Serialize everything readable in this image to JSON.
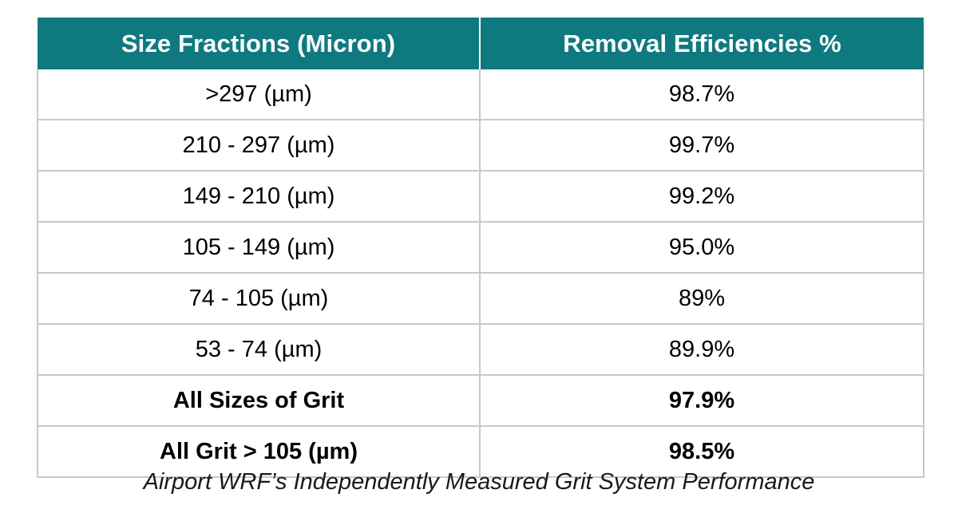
{
  "table": {
    "headers": [
      {
        "label": "Size Fractions (Micron)"
      },
      {
        "label": "Removal Efficiencies %"
      }
    ],
    "rows": [
      {
        "size": ">297 (µm)",
        "efficiency": "98.7%",
        "emphasis": false
      },
      {
        "size": "210 - 297 (µm)",
        "efficiency": "99.7%",
        "emphasis": false
      },
      {
        "size": "149 - 210 (µm)",
        "efficiency": "99.2%",
        "emphasis": false
      },
      {
        "size": "105 - 149 (µm)",
        "efficiency": "95.0%",
        "emphasis": false
      },
      {
        "size": "74 - 105 (µm)",
        "efficiency": "89%",
        "emphasis": false
      },
      {
        "size": "53 - 74 (µm)",
        "efficiency": "89.9%",
        "emphasis": false
      },
      {
        "size": "All Sizes of Grit",
        "efficiency": "97.9%",
        "emphasis": true
      },
      {
        "size": "All Grit > 105 (µm)",
        "efficiency": "98.5%",
        "emphasis": true
      }
    ]
  },
  "caption": {
    "text": "Airport WRF’s Independently Measured Grit System Performance"
  },
  "colors": {
    "header_background": "#0E7A80",
    "header_text": "#FFFFFF",
    "grid_line": "#C9C9C9",
    "body_text": "#000000",
    "page_background": "#FFFFFF"
  },
  "chart_data": {
    "type": "table",
    "title": "Airport WRF’s Independently Measured Grit System Performance",
    "columns": [
      "Size Fractions (Micron)",
      "Removal Efficiencies %"
    ],
    "categories": [
      ">297 (µm)",
      "210 - 297 (µm)",
      "149 - 210 (µm)",
      "105 - 149 (µm)",
      "74 - 105 (µm)",
      "53 - 74 (µm)",
      "All Sizes of Grit",
      "All Grit > 105 (µm)"
    ],
    "values": [
      98.7,
      99.7,
      99.2,
      95.0,
      89,
      89.9,
      97.9,
      98.5
    ],
    "value_labels": [
      "98.7%",
      "99.7%",
      "99.2%",
      "95.0%",
      "89%",
      "89.9%",
      "97.9%",
      "98.5%"
    ],
    "ylabel": "Removal Efficiencies %",
    "xlabel": "Size Fractions (Micron)"
  }
}
